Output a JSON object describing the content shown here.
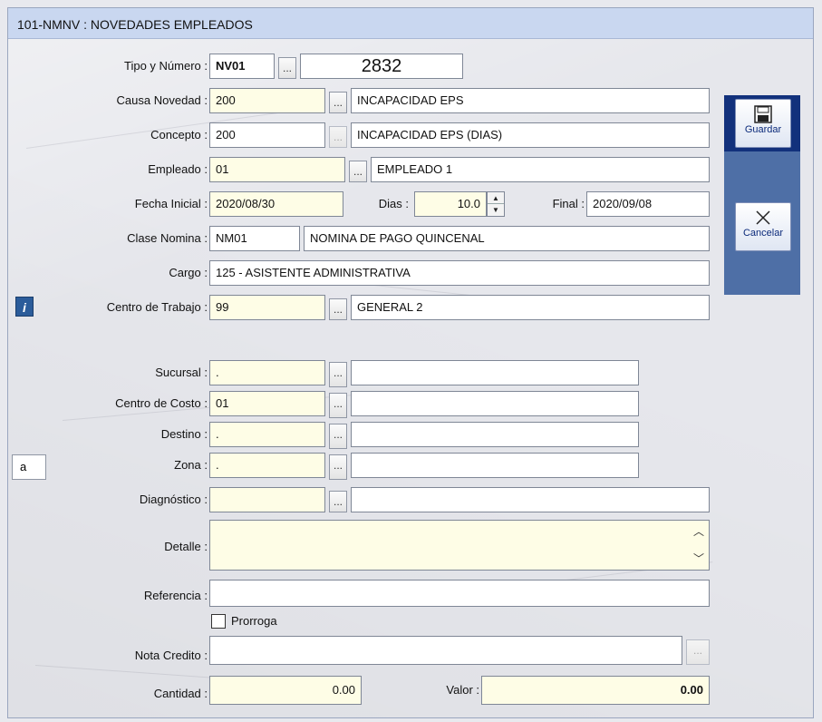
{
  "window": {
    "title": "101-NMNV : NOVEDADES EMPLEADOS"
  },
  "form": {
    "tipo_numero": {
      "label": "Tipo y Número :",
      "tipo": "NV01",
      "numero": "2832"
    },
    "causa": {
      "label": "Causa Novedad :",
      "code": "200",
      "desc": "INCAPACIDAD EPS"
    },
    "concepto": {
      "label": "Concepto :",
      "code": "200",
      "desc": "INCAPACIDAD EPS (DIAS)"
    },
    "empleado": {
      "label": "Empleado :",
      "code": "01",
      "desc": "EMPLEADO 1"
    },
    "fecha": {
      "label": "Fecha Inicial :",
      "inicial": "2020/08/30",
      "dias_label": "Dias :",
      "dias": "10.0",
      "final_label": "Final :",
      "final": "2020/09/08"
    },
    "clase_nomina": {
      "label": "Clase Nomina :",
      "code": "NM01",
      "desc": "NOMINA DE PAGO QUINCENAL"
    },
    "cargo": {
      "label": "Cargo :",
      "value": "125 - ASISTENTE ADMINISTRATIVA"
    },
    "centro_trabajo": {
      "label": "Centro de Trabajo :",
      "code": "99",
      "desc": "GENERAL 2"
    },
    "sucursal": {
      "label": "Sucursal :",
      "code": ".",
      "desc": ""
    },
    "centro_costo": {
      "label": "Centro de Costo :",
      "code": "01",
      "desc": ""
    },
    "destino": {
      "label": "Destino :",
      "code": ".",
      "desc": ""
    },
    "zona": {
      "label": "Zona :",
      "code": ".",
      "desc": ""
    },
    "diagnostico": {
      "label": "Diagnóstico :",
      "code": "",
      "desc": ""
    },
    "detalle": {
      "label": "Detalle :",
      "value": ""
    },
    "referencia": {
      "label": "Referencia :",
      "value": ""
    },
    "prorroga": {
      "label": "Prorroga",
      "checked": false
    },
    "nota_credito": {
      "label": "Nota Credito :",
      "value": ""
    },
    "cantidad": {
      "label": "Cantidad :",
      "value": "0.00"
    },
    "valor": {
      "label": "Valor :",
      "value": "0.00"
    }
  },
  "toolbar": {
    "save_label": "Guardar",
    "cancel_label": "Cancelar"
  },
  "side": {
    "a_value": "a"
  },
  "icons": {
    "dots": "...",
    "info": "i"
  },
  "colors": {
    "title_bg": "#c9d7f0",
    "toolbar_bg": "#4e6fa6",
    "toolbar_selected": "#12317c",
    "required_field": "#fefde6"
  }
}
